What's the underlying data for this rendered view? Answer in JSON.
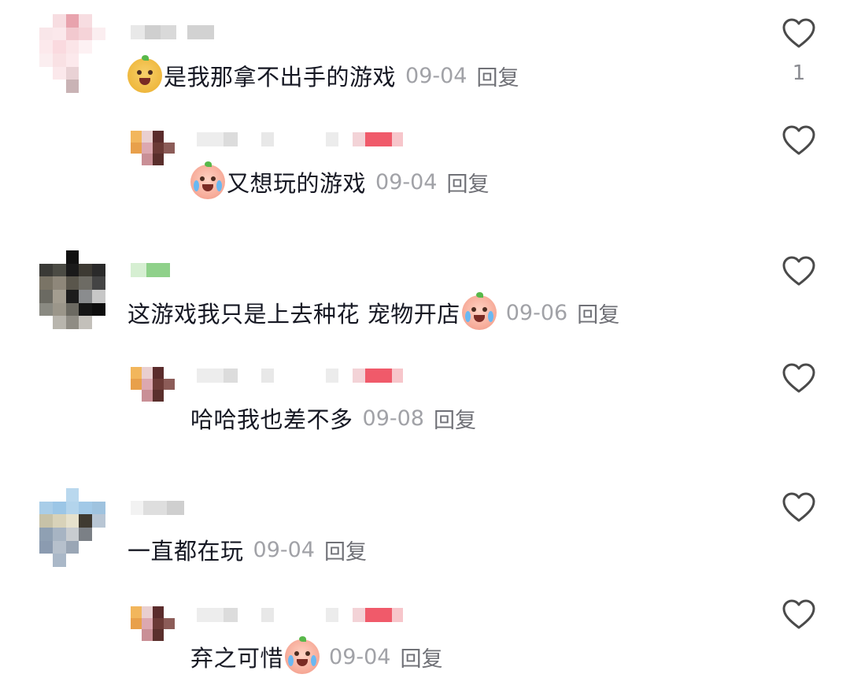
{
  "comments": [
    {
      "content": "是我那拿不出手的游戏",
      "date": "09-04",
      "reply_label": "回复",
      "like_count": "1",
      "emoji": "dog-emoji-prefix",
      "reply": true
    },
    {
      "content": "又想玩的游戏",
      "date": "09-04",
      "reply_label": "回复",
      "like_count": "",
      "emoji": "cry-emoji-prefix"
    },
    {
      "content": "这游戏我只是上去种花 宠物开店",
      "date": "09-06",
      "reply_label": "回复",
      "like_count": "",
      "emoji": "cry-emoji-suffix"
    },
    {
      "content": "哈哈我也差不多",
      "date": "09-08",
      "reply_label": "回复",
      "like_count": ""
    },
    {
      "content": "一直都在玩",
      "date": "09-04",
      "reply_label": "回复",
      "like_count": ""
    },
    {
      "content": "弃之可惜",
      "date": "09-04",
      "reply_label": "回复",
      "like_count": "",
      "emoji": "cry-emoji-suffix"
    }
  ],
  "icons": {
    "like": "heart-outline-icon",
    "emoji_dog": "dog-face-emoji",
    "emoji_cry": "crying-face-emoji"
  },
  "colors": {
    "text": "#161823",
    "date": "#a1a2a7",
    "reply": "#707177",
    "heart": "#4a4a4a"
  }
}
